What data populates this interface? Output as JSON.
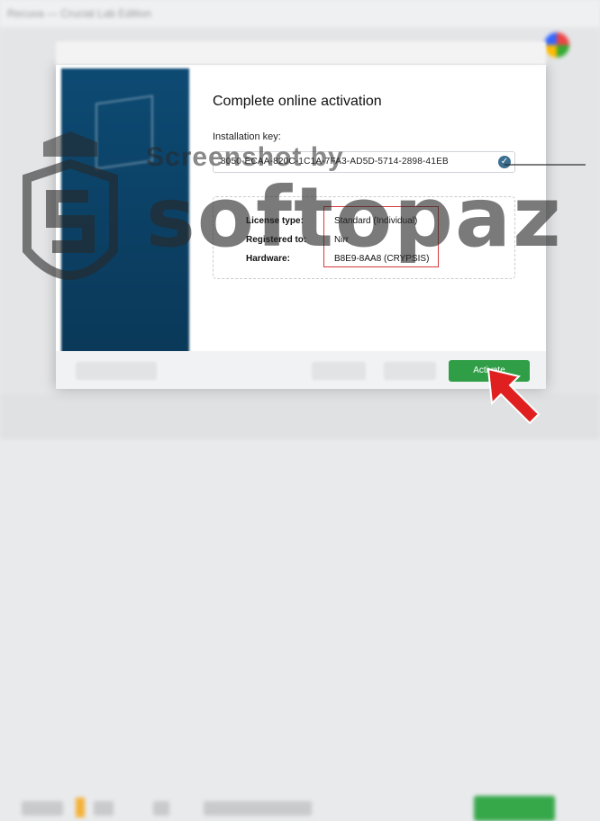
{
  "background": {
    "title": "Recuva — Crucial Lab Edition"
  },
  "dialog": {
    "heading": "Complete online activation",
    "installation_key_label": "Installation key:",
    "installation_key_value": "8050-ECAA-820C-1C1A-7FA3-AD5D-5714-2898-41EB",
    "license": {
      "rows": [
        {
          "label": "License type:",
          "value": "Standard (Individual)"
        },
        {
          "label": "Registered to:",
          "value": "Nirr"
        },
        {
          "label": "Hardware:",
          "value": "B8E9-8AA8 (CRYPSIS)"
        }
      ]
    },
    "activate_label": "Activate"
  },
  "watermark": {
    "line1": "Screenshot by",
    "line2": "softopaz"
  },
  "colors": {
    "side_panel": "#0d4a73",
    "activate": "#2f9e47",
    "highlight": "#d63a3a",
    "arrow": "#e02020"
  }
}
